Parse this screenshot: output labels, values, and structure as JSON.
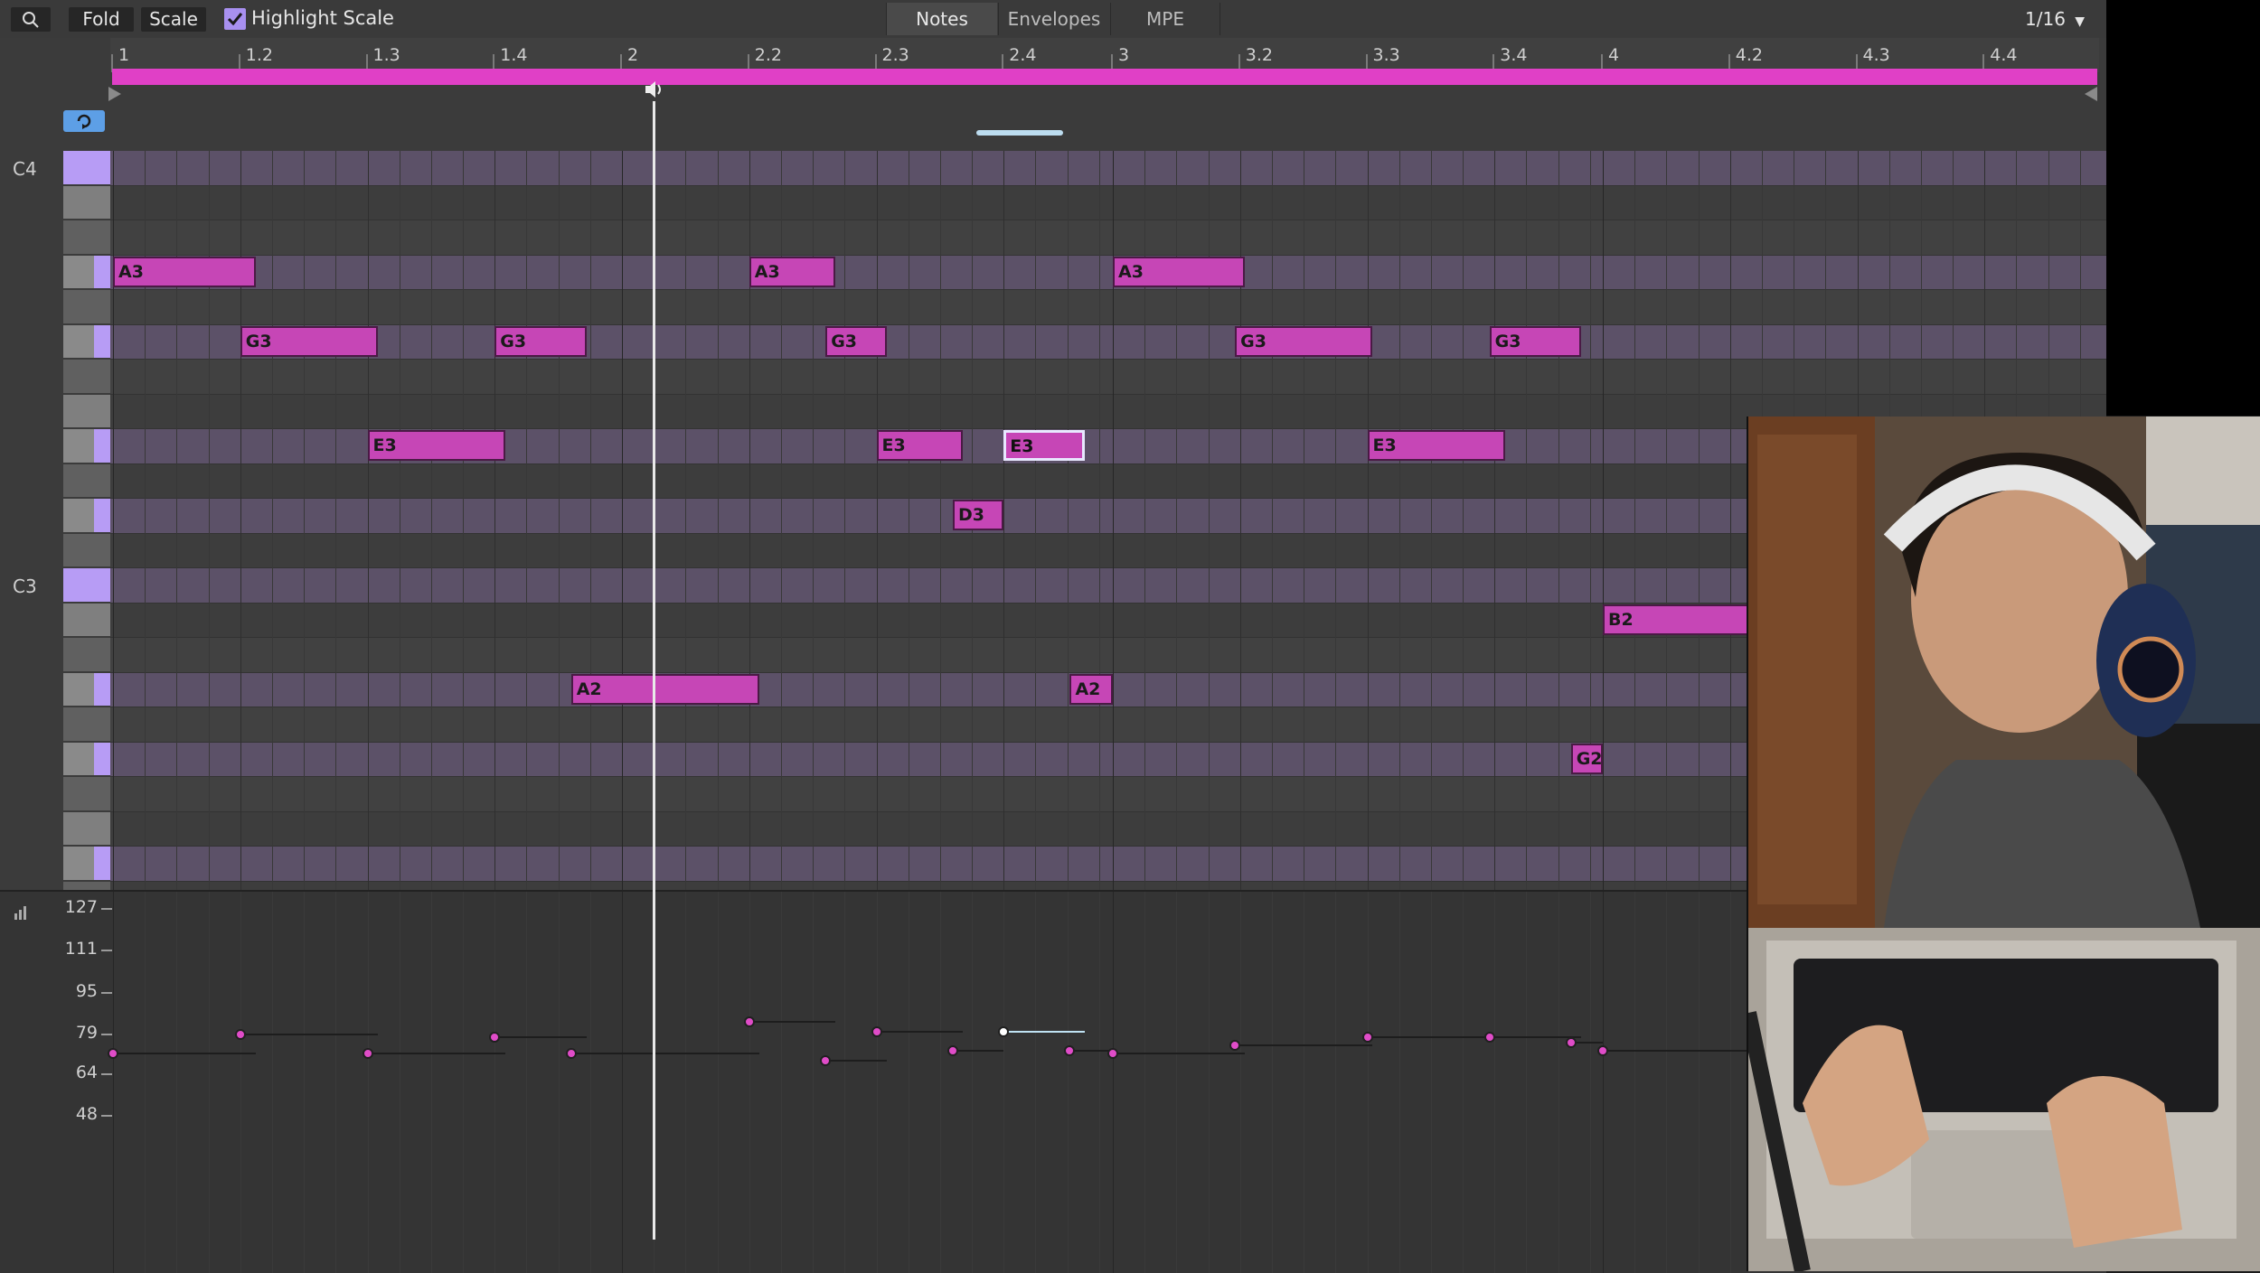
{
  "toolbar": {
    "fold_label": "Fold",
    "scale_label": "Scale",
    "highlight_scale_label": "Highlight Scale",
    "highlight_scale_checked": true,
    "tabs": [
      {
        "label": "Notes",
        "active": true
      },
      {
        "label": "Envelopes",
        "active": false
      },
      {
        "label": "MPE",
        "active": false
      }
    ],
    "grid_value": "1/16"
  },
  "ruler": {
    "labels": [
      "1",
      "1.2",
      "1.3",
      "1.4",
      "2",
      "2.2",
      "2.3",
      "2.4",
      "3",
      "3.2",
      "3.3",
      "3.4",
      "4",
      "4.2",
      "4.3",
      "4.4"
    ]
  },
  "keyboard": {
    "octave_labels": [
      "C4",
      "C3"
    ]
  },
  "notes": [
    {
      "pitch": "A3",
      "start": 1.0,
      "length": 0.28,
      "selected": false
    },
    {
      "pitch": "A3",
      "start": 2.25,
      "length": 0.17,
      "selected": false
    },
    {
      "pitch": "A3",
      "start": 3.0,
      "length": 0.26,
      "selected": false
    },
    {
      "pitch": "G3",
      "start": 1.25,
      "length": 0.27,
      "selected": false
    },
    {
      "pitch": "G3",
      "start": 1.75,
      "length": 0.18,
      "selected": false
    },
    {
      "pitch": "G3",
      "start": 2.4,
      "length": 0.12,
      "selected": false
    },
    {
      "pitch": "G3",
      "start": 3.24,
      "length": 0.27,
      "selected": false
    },
    {
      "pitch": "G3",
      "start": 3.74,
      "length": 0.18,
      "selected": false
    },
    {
      "pitch": "E3",
      "start": 1.5,
      "length": 0.27,
      "selected": false
    },
    {
      "pitch": "E3",
      "start": 2.5,
      "length": 0.17,
      "selected": false
    },
    {
      "pitch": "E3",
      "start": 2.75,
      "length": 0.16,
      "selected": true
    },
    {
      "pitch": "E3",
      "start": 3.5,
      "length": 0.27,
      "selected": false
    },
    {
      "pitch": "D3",
      "start": 2.65,
      "length": 0.1,
      "selected": false
    },
    {
      "pitch": "B2",
      "start": 4.0,
      "length": 0.3,
      "selected": false
    },
    {
      "pitch": "A2",
      "start": 1.9,
      "length": 0.37,
      "selected": false
    },
    {
      "pitch": "A2",
      "start": 2.88,
      "length": 0.12,
      "selected": false
    },
    {
      "pitch": "G2",
      "start": 3.9,
      "length": 0.1,
      "selected": false
    }
  ],
  "velocity": {
    "scale_labels": [
      "127",
      "111",
      "95",
      "79",
      "64",
      "48"
    ],
    "points": [
      {
        "start": 1.0,
        "length": 0.28,
        "value": 72
      },
      {
        "start": 1.25,
        "length": 0.27,
        "value": 79
      },
      {
        "start": 1.5,
        "length": 0.27,
        "value": 72
      },
      {
        "start": 1.75,
        "length": 0.18,
        "value": 78
      },
      {
        "start": 1.9,
        "length": 0.37,
        "value": 72
      },
      {
        "start": 2.25,
        "length": 0.17,
        "value": 84
      },
      {
        "start": 2.4,
        "length": 0.12,
        "value": 69
      },
      {
        "start": 2.5,
        "length": 0.17,
        "value": 80
      },
      {
        "start": 2.65,
        "length": 0.1,
        "value": 73
      },
      {
        "start": 2.75,
        "length": 0.16,
        "value": 80,
        "selected": true
      },
      {
        "start": 2.88,
        "length": 0.12,
        "value": 73
      },
      {
        "start": 3.0,
        "length": 0.26,
        "value": 72
      },
      {
        "start": 3.24,
        "length": 0.27,
        "value": 75
      },
      {
        "start": 3.5,
        "length": 0.27,
        "value": 78
      },
      {
        "start": 3.74,
        "length": 0.18,
        "value": 78
      },
      {
        "start": 3.9,
        "length": 0.1,
        "value": 76
      },
      {
        "start": 4.0,
        "length": 0.3,
        "value": 73
      }
    ]
  },
  "colors": {
    "note": "#c646b6",
    "loop": "#e040c6",
    "scale_row": "#5c5168",
    "key_highlight": "#b79cf5"
  },
  "icons": [
    "search-icon",
    "checkbox-icon",
    "dropdown-arrow-icon",
    "loop-icon",
    "speaker-icon",
    "velocity-icon"
  ]
}
